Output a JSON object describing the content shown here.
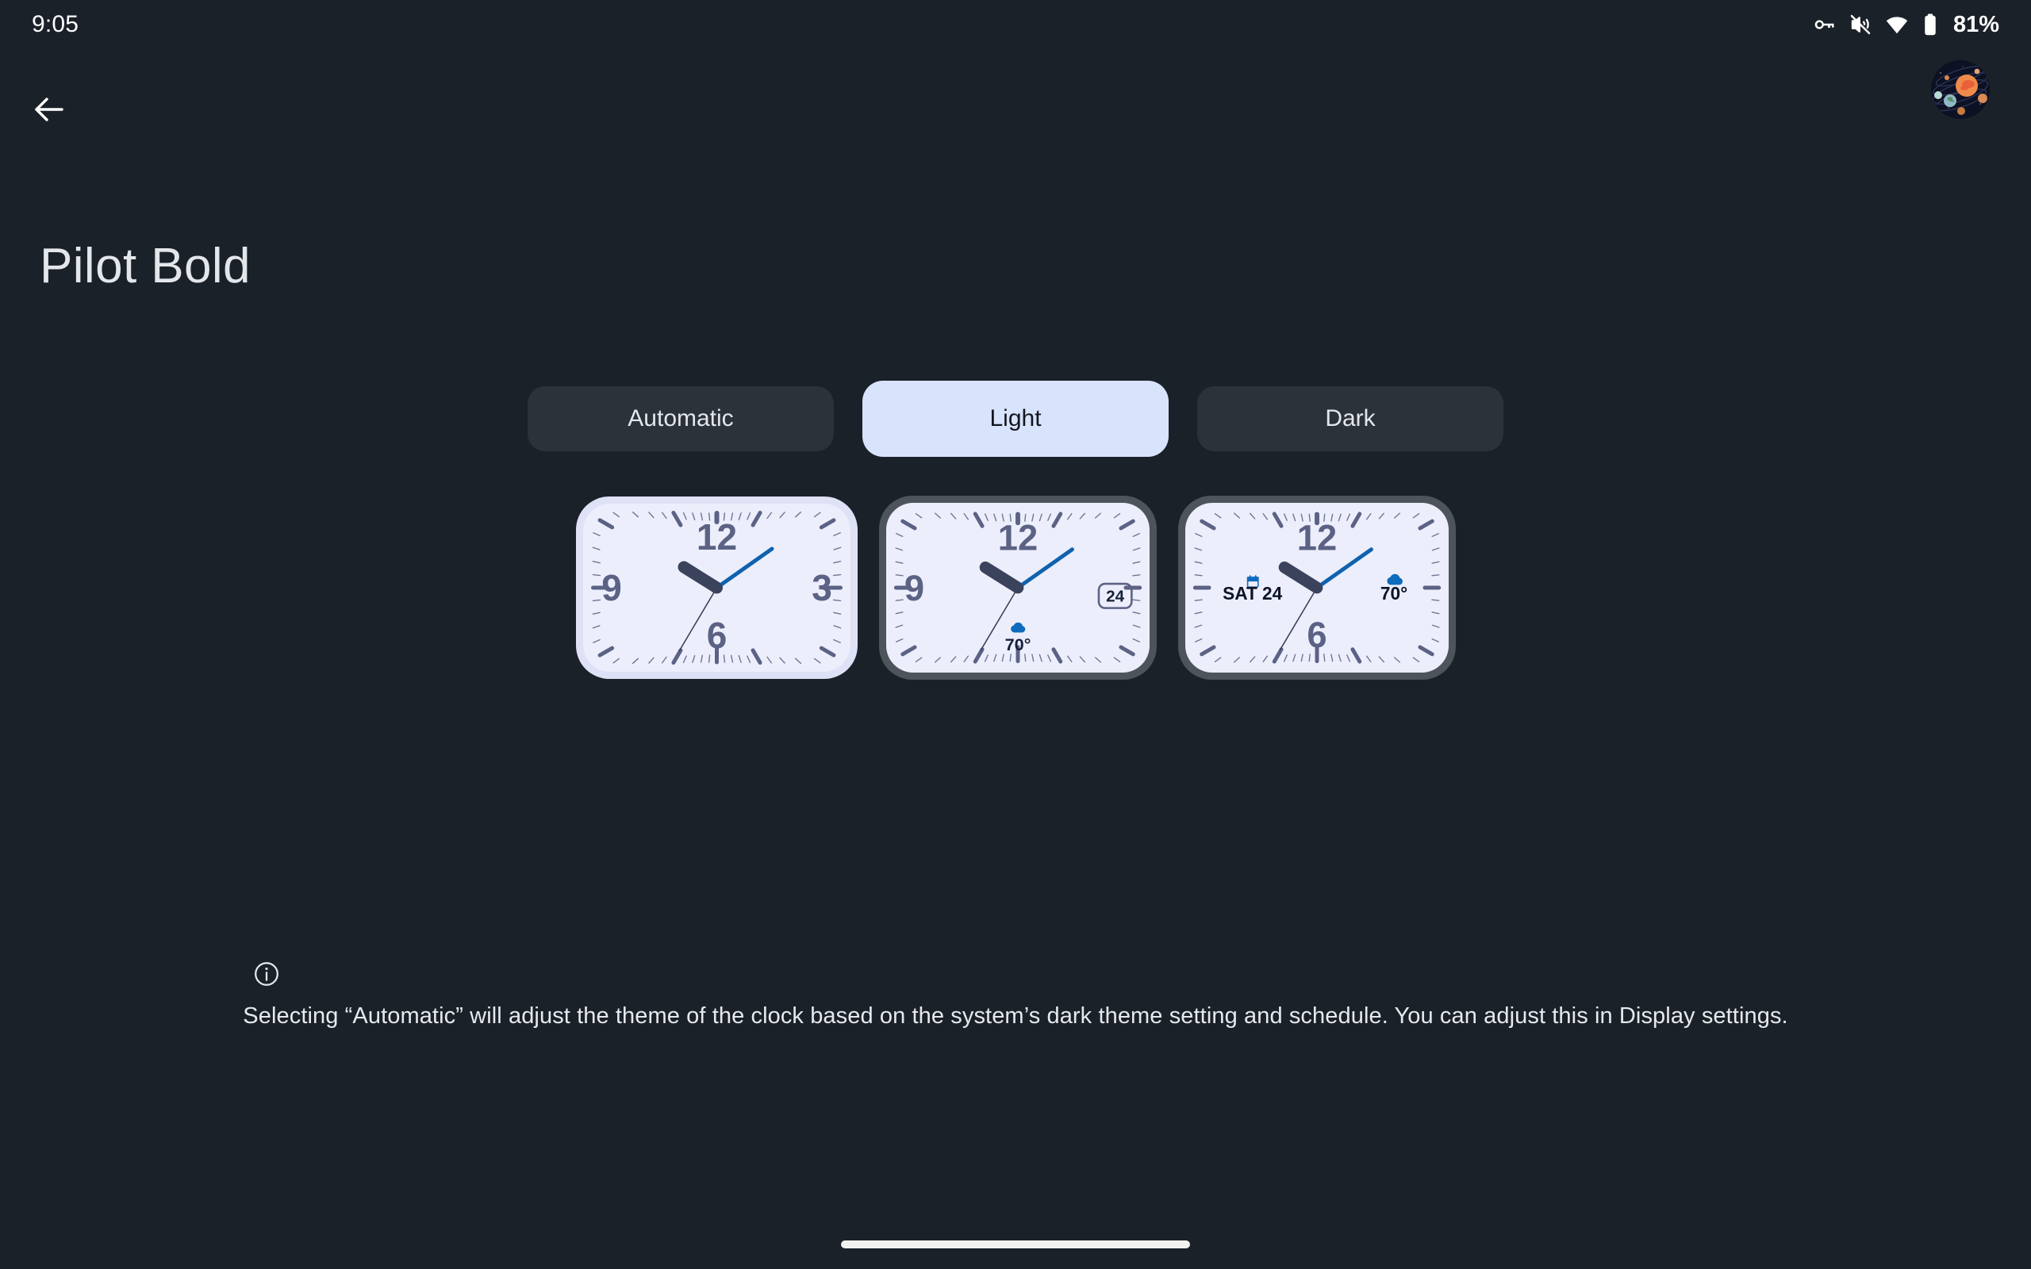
{
  "status_bar": {
    "time": "9:05",
    "battery_percent": "81%",
    "icons": [
      "vpn-key-icon",
      "volume-off-icon",
      "wifi-icon",
      "battery-icon"
    ]
  },
  "nav": {
    "back_icon": "arrow-back-icon",
    "avatar_icon": "solar-system-avatar"
  },
  "header": {
    "title": "Pilot Bold"
  },
  "theme_selector": {
    "options": [
      {
        "label": "Automatic",
        "selected": false
      },
      {
        "label": "Light",
        "selected": true
      },
      {
        "label": "Dark",
        "selected": false
      }
    ]
  },
  "clock_previews": [
    {
      "variant": "no-complications",
      "border_color": "#dfe1f7",
      "face_color": "#eceefb",
      "numerals": [
        "12",
        "3",
        "6",
        "9"
      ],
      "complications": []
    },
    {
      "variant": "date-and-weather",
      "border_color": "#4d545c",
      "face_color": "#eceefb",
      "numerals": [
        "12",
        "9"
      ],
      "complications": [
        {
          "type": "date-boxed",
          "value": "24",
          "position": "right"
        },
        {
          "type": "weather",
          "icon": "cloud-icon",
          "value": "70°",
          "position": "bottom"
        }
      ]
    },
    {
      "variant": "date-weather-sides",
      "border_color": "#4d545c",
      "face_color": "#eceefb",
      "numerals": [
        "12",
        "6"
      ],
      "complications": [
        {
          "type": "date-long",
          "icon": "calendar-icon",
          "value": "SAT 24",
          "position": "left"
        },
        {
          "type": "weather",
          "icon": "cloud-icon",
          "value": "70°",
          "position": "right"
        }
      ]
    }
  ],
  "footer": {
    "info_icon": "info-icon",
    "info_text": "Selecting “Automatic” will adjust the theme of the clock based on the system’s dark theme setting and schedule. You can adjust this in Display settings."
  },
  "colors": {
    "background": "#1b2128",
    "segment_unselected": "#2c323a",
    "segment_selected": "#d7e4fb",
    "clock_hand_hour": "#3a425c",
    "clock_minute_hand": "#0f62ae",
    "accent_blue": "#0f6bbd",
    "numeral": "#5b6284",
    "home_indicator": "#f1f1f0"
  }
}
